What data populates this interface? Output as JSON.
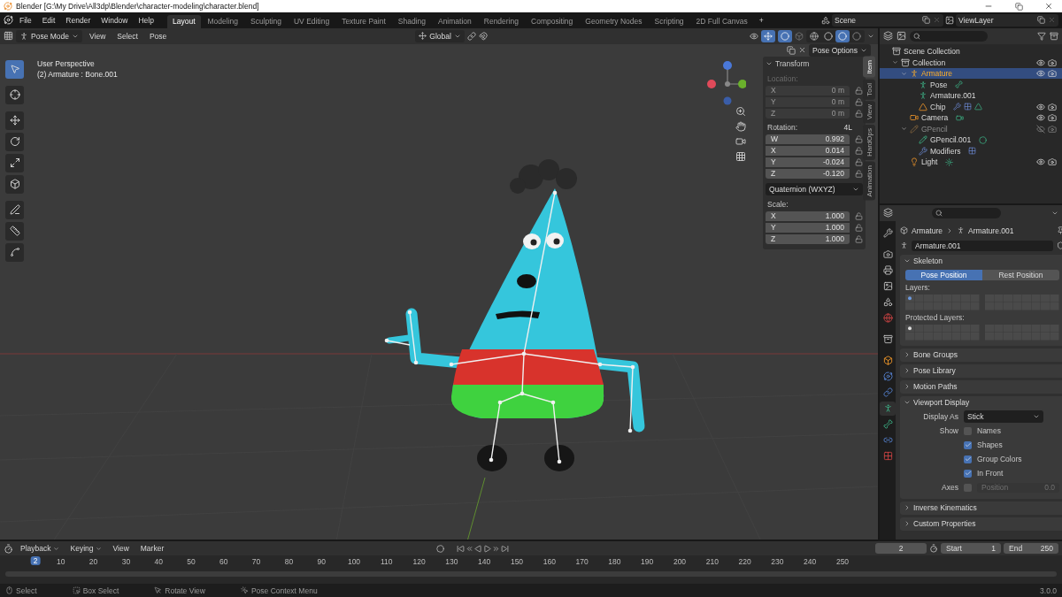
{
  "window": {
    "title": "Blender [G:\\My Drive\\All3dp\\Blender\\character-modeling\\character.blend]"
  },
  "menu": [
    "File",
    "Edit",
    "Render",
    "Window",
    "Help"
  ],
  "workspaces": [
    {
      "label": "Layout",
      "selected": true
    },
    {
      "label": "Modeling",
      "selected": false
    },
    {
      "label": "Sculpting",
      "selected": false
    },
    {
      "label": "UV Editing",
      "selected": false
    },
    {
      "label": "Texture Paint",
      "selected": false
    },
    {
      "label": "Shading",
      "selected": false
    },
    {
      "label": "Animation",
      "selected": false
    },
    {
      "label": "Rendering",
      "selected": false
    },
    {
      "label": "Compositing",
      "selected": false
    },
    {
      "label": "Geometry Nodes",
      "selected": false
    },
    {
      "label": "Scripting",
      "selected": false
    },
    {
      "label": "2D Full Canvas",
      "selected": false
    }
  ],
  "add_workspace": "+",
  "scene": "Scene",
  "view_layer": "ViewLayer",
  "viewport": {
    "mode": "Pose Mode",
    "menus": [
      "View",
      "Select",
      "Pose"
    ],
    "orientation": "Global",
    "pose_options": "Pose Options",
    "view_name": "User Perspective",
    "object_info": "(2) Armature : Bone.001",
    "tools": [
      {
        "kind": "select",
        "selected": true
      },
      {
        "kind": "cursor",
        "selected": false
      },
      {
        "kind": "move",
        "selected": false
      },
      {
        "kind": "rotate",
        "selected": false
      },
      {
        "kind": "scale",
        "selected": false
      },
      {
        "kind": "transform",
        "selected": false
      },
      {
        "kind": "annotate",
        "selected": false
      },
      {
        "kind": "measure",
        "selected": false
      },
      {
        "kind": "relax",
        "selected": false
      }
    ],
    "shading": [
      {
        "kind": "wireframe",
        "selected": false
      },
      {
        "kind": "solid",
        "selected": false
      },
      {
        "kind": "material",
        "selected": true
      },
      {
        "kind": "rendered",
        "selected": false
      }
    ]
  },
  "sidebar": {
    "tabs": [
      {
        "label": "Item",
        "selected": true
      },
      {
        "label": "Tool",
        "selected": false
      },
      {
        "label": "View",
        "selected": false
      },
      {
        "label": "HardOps",
        "selected": false
      },
      {
        "label": "Animation",
        "selected": false
      }
    ],
    "title": "Transform",
    "items": [
      {
        "kind": "group",
        "label": "Location:",
        "disabled": true,
        "rows": [
          {
            "axis": "X",
            "value": "0 m"
          },
          {
            "axis": "Y",
            "value": "0 m"
          },
          {
            "axis": "Z",
            "value": "0 m"
          }
        ]
      },
      {
        "kind": "group",
        "label": "Rotation:",
        "badge": "4L",
        "disabled": false,
        "rows": [
          {
            "axis": "W",
            "value": "0.992"
          },
          {
            "axis": "X",
            "value": "0.014"
          },
          {
            "axis": "Y",
            "value": "-0.024"
          },
          {
            "axis": "Z",
            "value": "-0.120"
          }
        ]
      },
      {
        "kind": "dropdown",
        "value": "Quaternion (WXYZ)"
      },
      {
        "kind": "group",
        "label": "Scale:",
        "disabled": false,
        "rows": [
          {
            "axis": "X",
            "value": "1.000"
          },
          {
            "axis": "Y",
            "value": "1.000"
          },
          {
            "axis": "Z",
            "value": "1.000"
          }
        ]
      }
    ]
  },
  "outliner": {
    "items": [
      {
        "name": "Scene Collection",
        "kind": "collection",
        "selected": false,
        "disabled": false,
        "children": [
          {
            "name": "Collection",
            "kind": "collection",
            "selected": false,
            "disabled": false,
            "visible": true,
            "children": [
              {
                "name": "Armature",
                "kind": "armature",
                "selected": true,
                "disabled": false,
                "visible": true,
                "children": [
                  {
                    "name": "Pose",
                    "kind": "pose",
                    "selected": false,
                    "disabled": false,
                    "extras": [
                      {
                        "kind": "bone"
                      }
                    ]
                  },
                  {
                    "name": "Armature.001",
                    "kind": "armature_data",
                    "selected": false,
                    "disabled": false
                  },
                  {
                    "name": "Chip",
                    "kind": "mesh",
                    "selected": false,
                    "disabled": false,
                    "visible": true,
                    "extras": [
                      {
                        "kind": "modifiers"
                      },
                      {
                        "kind": "vertex_groups"
                      },
                      {
                        "kind": "mesh_data"
                      }
                    ]
                  }
                ]
              },
              {
                "name": "Camera",
                "kind": "camera",
                "selected": false,
                "disabled": false,
                "visible": true,
                "extras": [
                  {
                    "kind": "camera_data"
                  }
                ]
              },
              {
                "name": "GPencil",
                "kind": "gpencil",
                "selected": false,
                "disabled": true,
                "visible": false,
                "children": [
                  {
                    "name": "GPencil.001",
                    "kind": "gpencil_data",
                    "selected": false,
                    "disabled": false,
                    "extras": [
                      {
                        "kind": "material"
                      }
                    ]
                  },
                  {
                    "name": "Modifiers",
                    "kind": "modifiers",
                    "selected": false,
                    "disabled": false,
                    "extras": [
                      {
                        "kind": "vertex_groups"
                      }
                    ]
                  }
                ]
              },
              {
                "name": "Light",
                "kind": "light",
                "selected": false,
                "disabled": false,
                "visible": true,
                "extras": [
                  {
                    "kind": "light_data"
                  }
                ]
              }
            ]
          }
        ]
      }
    ]
  },
  "properties": {
    "tabs": [
      {
        "kind": "tool",
        "selected": false
      },
      {
        "kind": "render",
        "selected": false
      },
      {
        "kind": "output",
        "selected": false
      },
      {
        "kind": "view_layer",
        "selected": false
      },
      {
        "kind": "scene",
        "selected": false
      },
      {
        "kind": "world",
        "selected": false
      },
      {
        "kind": "collection",
        "selected": false
      },
      {
        "kind": "object",
        "selected": false
      },
      {
        "kind": "physics",
        "selected": false
      },
      {
        "kind": "constraints",
        "selected": false
      },
      {
        "kind": "data",
        "selected": true
      },
      {
        "kind": "bone",
        "selected": false
      },
      {
        "kind": "bone_constraints",
        "selected": false
      },
      {
        "kind": "texture",
        "selected": false
      }
    ],
    "breadcrumb": [
      "Armature",
      "Armature.001"
    ],
    "data_name": "Armature.001",
    "panels": [
      {
        "title": "Skeleton",
        "kind": "skeleton",
        "expanded": true,
        "positions": [
          {
            "label": "Pose Position",
            "selected": true
          },
          {
            "label": "Rest Position",
            "selected": false
          }
        ],
        "layers_label": "Layers:",
        "protected_label": "Protected Layers:"
      },
      {
        "title": "Bone Groups",
        "expanded": false
      },
      {
        "title": "Pose Library",
        "expanded": false
      },
      {
        "title": "Motion Paths",
        "expanded": false
      },
      {
        "title": "Viewport Display",
        "kind": "display",
        "expanded": true,
        "display_as_label": "Display As",
        "display_as": "Stick",
        "show_label": "Show",
        "options": [
          {
            "label": "Names",
            "checked": false
          },
          {
            "label": "Shapes",
            "checked": true
          },
          {
            "label": "Group Colors",
            "checked": true
          },
          {
            "label": "In Front",
            "checked": true
          }
        ],
        "axes_label": "Axes",
        "axes_checked": false,
        "axes_position": "Position",
        "axes_value": "0.0"
      },
      {
        "title": "Inverse Kinematics",
        "expanded": false
      },
      {
        "title": "Custom Properties",
        "expanded": false
      }
    ]
  },
  "timeline": {
    "menus": [
      "Playback",
      "Keying",
      "View",
      "Marker"
    ],
    "current_frame": "2",
    "start_label": "Start",
    "start": "1",
    "end_label": "End",
    "end": "250",
    "ruler": [
      {
        "label": "2",
        "current": true
      },
      {
        "label": "10",
        "current": false
      },
      {
        "label": "20",
        "current": false
      },
      {
        "label": "30",
        "current": false
      },
      {
        "label": "40",
        "current": false
      },
      {
        "label": "50",
        "current": false
      },
      {
        "label": "60",
        "current": false
      },
      {
        "label": "70",
        "current": false
      },
      {
        "label": "80",
        "current": false
      },
      {
        "label": "90",
        "current": false
      },
      {
        "label": "100",
        "current": false
      },
      {
        "label": "110",
        "current": false
      },
      {
        "label": "120",
        "current": false
      },
      {
        "label": "130",
        "current": false
      },
      {
        "label": "140",
        "current": false
      },
      {
        "label": "150",
        "current": false
      },
      {
        "label": "160",
        "current": false
      },
      {
        "label": "170",
        "current": false
      },
      {
        "label": "180",
        "current": false
      },
      {
        "label": "190",
        "current": false
      },
      {
        "label": "200",
        "current": false
      },
      {
        "label": "210",
        "current": false
      },
      {
        "label": "220",
        "current": false
      },
      {
        "label": "230",
        "current": false
      },
      {
        "label": "240",
        "current": false
      },
      {
        "label": "250",
        "current": false
      }
    ]
  },
  "status_bar": {
    "items": [
      {
        "kind": "left_click",
        "label": "Select"
      },
      {
        "kind": "drag",
        "label": "Box Select"
      },
      {
        "kind": "middle_click",
        "label": "Rotate View"
      },
      {
        "kind": "right_click",
        "label": "Pose Context Menu"
      }
    ],
    "version": "3.0.0"
  }
}
